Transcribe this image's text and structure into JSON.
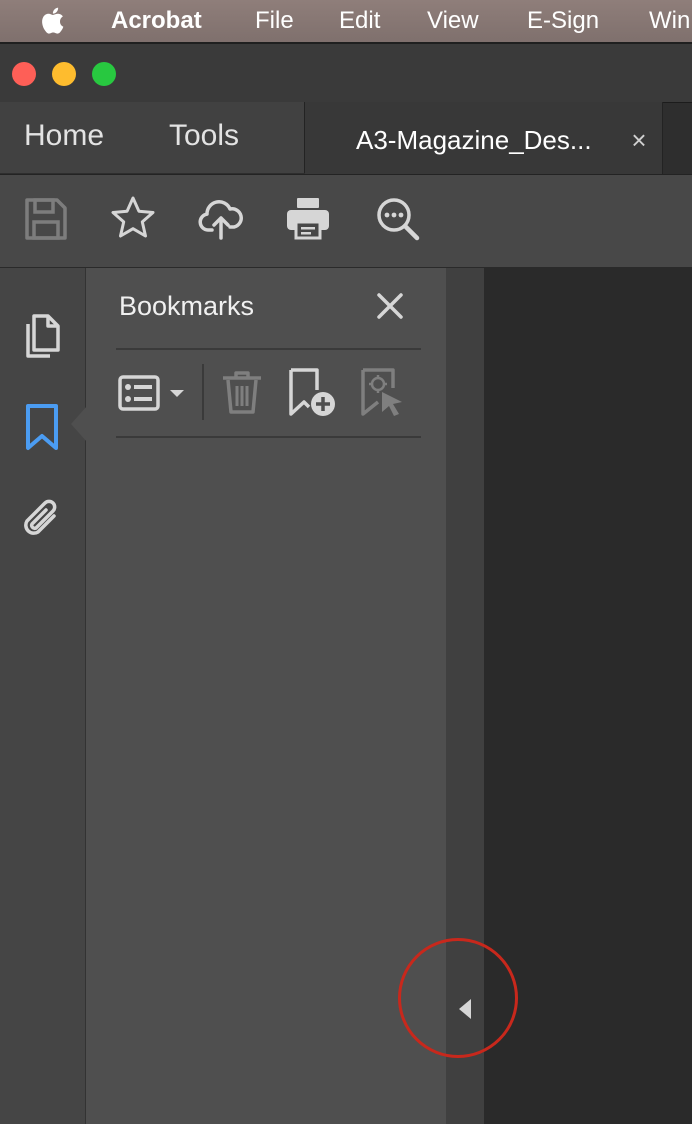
{
  "menubar": {
    "apple_icon": "apple-icon",
    "items": [
      "Acrobat",
      "File",
      "Edit",
      "View",
      "E-Sign",
      "Win"
    ]
  },
  "window": {
    "traffic_lights": {
      "close": "#fe5f57",
      "minimize": "#febc2e",
      "zoom": "#28c840"
    }
  },
  "tabs": {
    "home": "Home",
    "tools": "Tools",
    "document": "A3-Magazine_Des...",
    "close_symbol": "×"
  },
  "toolbar": {
    "icons": [
      "save-icon",
      "star-icon",
      "upload-cloud-icon",
      "print-icon",
      "search-zoom-icon"
    ]
  },
  "left_rail": {
    "icons": [
      "pages-icon",
      "bookmark-icon",
      "attachment-icon"
    ],
    "active": "bookmark-icon",
    "active_color": "#4b9cf2"
  },
  "bookmarks_panel": {
    "title": "Bookmarks",
    "tools": [
      "options-menu-icon",
      "delete-icon",
      "add-bookmark-icon",
      "bookmark-target-icon"
    ]
  },
  "annotation": {
    "highlight_color": "#c8281c"
  }
}
